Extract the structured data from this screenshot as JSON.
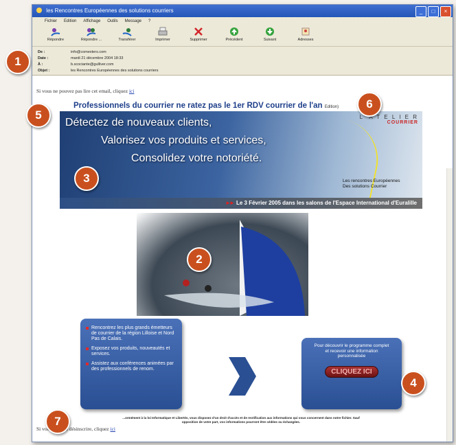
{
  "window": {
    "title": "les Rencontres Européennes des solutions courriers"
  },
  "menu": [
    "Fichier",
    "Edition",
    "Affichage",
    "Outils",
    "Message",
    "?"
  ],
  "toolbar": [
    {
      "label": "Répondre",
      "icon": "reply-icon"
    },
    {
      "label": "Répondre ...",
      "icon": "reply-all-icon"
    },
    {
      "label": "Transférer",
      "icon": "forward-icon"
    },
    {
      "label": "Imprimer",
      "icon": "print-icon"
    },
    {
      "label": "Supprimer",
      "icon": "delete-icon"
    },
    {
      "label": "Précédent",
      "icon": "previous-icon"
    },
    {
      "label": "Suivant",
      "icon": "next-icon"
    },
    {
      "label": "Adresses",
      "icon": "addresses-icon"
    }
  ],
  "header": {
    "from_label": "De :",
    "from": "info@comexters.com",
    "date_label": "Date :",
    "date": "mardi 21 décembre 2004 18:33",
    "to_label": "À :",
    "to": "b.scociante@gulliver.com",
    "subject_label": "Objet :",
    "subject": "les Rencontres Européennes des solutions courriers"
  },
  "email": {
    "top_note": "Si vous ne pouvez pas lire cet email, cliquez ",
    "top_link": "ici",
    "headline": "Professionnels du courrier ne ratez pas le 1er RDV courrier de l'an",
    "headline_suffix": "Edition)",
    "banner_line1": "Détectez de nouveaux clients,",
    "banner_line2": "Valorisez vos produits et services,",
    "banner_line3": "Consolidez votre notoriété.",
    "brand_top": "L' A T E L I E R",
    "brand_bottom": "COURRIER",
    "brand_tagline1": "Les rencontres Européennes",
    "brand_tagline2": "Des solutions Courrier",
    "banner_footer": "Le 3 Février 2005 dans les salons de l'Espace International d'Euralille",
    "bullets": [
      "Rencontrez les plus grands émetteurs de courrier de la région Lilloise et Nord Pas de Calais.",
      "Exposez vos produits, nouveautés et services.",
      "Assistez aux conférences animées par des professionnels de renom."
    ],
    "cta_text": "Pour découvrir le programme complet et recevoir une information personnalisée",
    "cta_button": "CLIQUEZ ICI",
    "legal_line1": "...ormément à la loi Informatique et Libertés, vous disposez d'un droit d'accès et de rectification aux informations qui vous concernent dans notre fichier. Sauf",
    "legal_line2": "opposition de votre part, vos informations pourront être cédées ou échangées.",
    "bottom_note": "Si vous ... vous désinscrire, cliquez ",
    "bottom_link": "ici"
  },
  "badges": [
    "1",
    "2",
    "3",
    "4",
    "5",
    "6",
    "7"
  ]
}
